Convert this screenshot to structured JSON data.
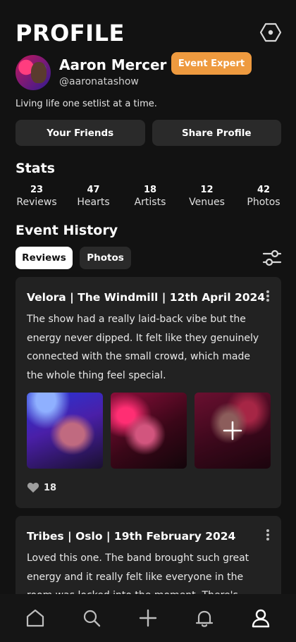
{
  "header": {
    "title": "PROFILE",
    "settings_icon": "hexagon-settings-icon"
  },
  "profile": {
    "name": "Aaron Mercer",
    "handle": "@aaronatashow",
    "badge": "Event Expert",
    "badge_color": "#ee9a3f",
    "bio": "Living life one setlist at a time."
  },
  "actions": {
    "friends_label": "Your Friends",
    "share_label": "Share Profile"
  },
  "stats": {
    "title": "Stats",
    "items": [
      {
        "value": "23",
        "label": "Reviews"
      },
      {
        "value": "47",
        "label": "Hearts"
      },
      {
        "value": "18",
        "label": "Artists"
      },
      {
        "value": "12",
        "label": "Venues"
      },
      {
        "value": "42",
        "label": "Photos"
      }
    ]
  },
  "history": {
    "title": "Event History",
    "tabs": [
      {
        "label": "Reviews",
        "active": true
      },
      {
        "label": "Photos",
        "active": false
      }
    ],
    "filter_icon": "sliders-icon",
    "reviews": [
      {
        "title": "Velora | The Windmill | 12th April 2024",
        "body": "The show had a really laid-back vibe but the energy never dipped.  It felt like they genuinely connected with the small crowd, which made the whole thing feel special.",
        "likes": "18"
      },
      {
        "title": "Tribes | Oslo | 19th February 2024",
        "body": "Loved this one. The band brought such great energy and it really felt like everyone in the room was locked into the moment. There's"
      }
    ]
  },
  "nav": {
    "items": [
      "home-icon",
      "search-icon",
      "plus-icon",
      "bell-icon",
      "user-icon"
    ],
    "active": "user-icon"
  },
  "colors": {
    "background": "#121212",
    "card": "#222222",
    "button": "#2a2a2a",
    "accent": "#ee9a3f"
  }
}
